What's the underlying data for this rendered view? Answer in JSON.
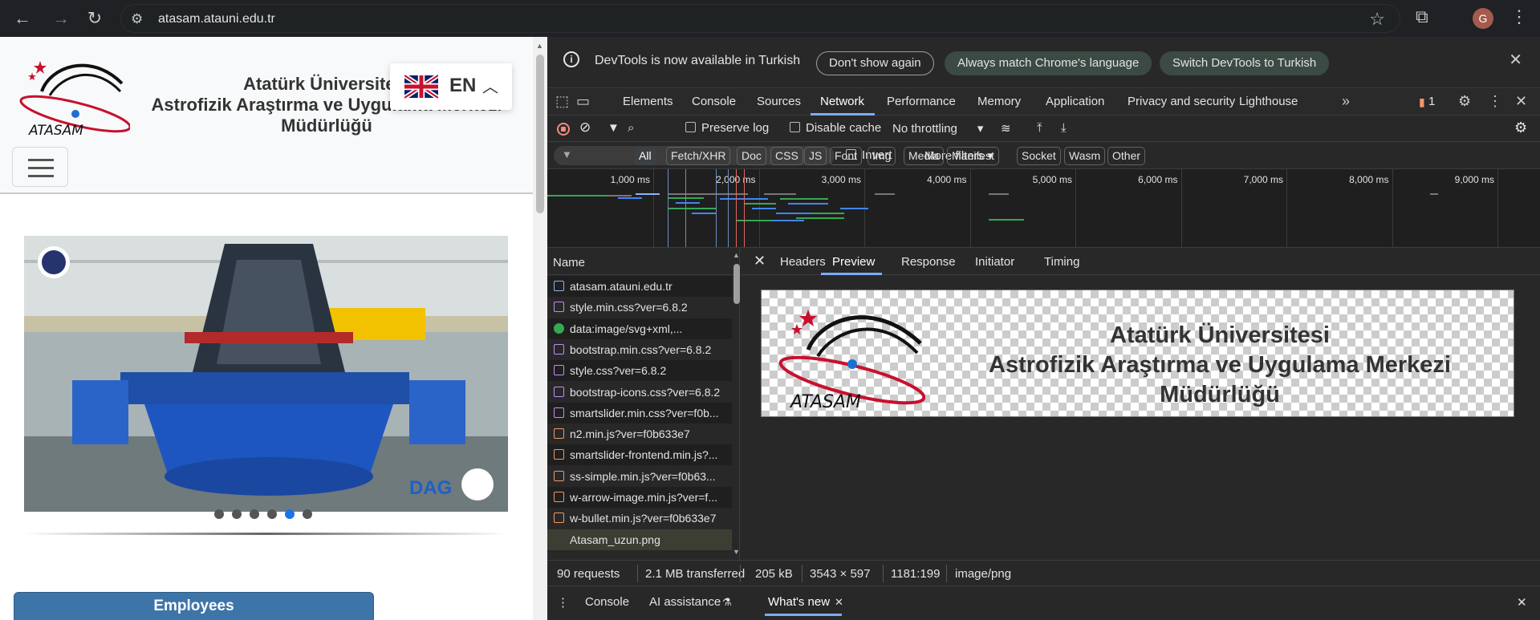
{
  "browser": {
    "url": "atasam.atauni.edu.tr",
    "avatar_letter": "G"
  },
  "site": {
    "logo_text": "ATASAM",
    "title_lines": [
      "Atatürk Üniversitesi",
      "Astrofizik Araştırma ve Uygulama Merkezi",
      "Müdürlüğü"
    ],
    "language": "EN",
    "slider_dots": 6,
    "slider_active_dot": 5,
    "slide_badge": "DAG",
    "employees_label": "Employees"
  },
  "devtools": {
    "infobar": {
      "message": "DevTools is now available in Turkish",
      "dont_show": "Don't show again",
      "always_match": "Always match Chrome's language",
      "switch": "Switch DevTools to Turkish"
    },
    "tabs": [
      "Elements",
      "Console",
      "Sources",
      "Network",
      "Performance",
      "Memory",
      "Application",
      "Privacy and security",
      "Lighthouse"
    ],
    "selected_tab": "Network",
    "issues_count": "1",
    "toolbar": {
      "preserve_log": "Preserve log",
      "disable_cache": "Disable cache",
      "throttling": "No throttling"
    },
    "filter": {
      "invert": "Invert",
      "more_filters": "More filters",
      "types": [
        "All",
        "Fetch/XHR",
        "Doc",
        "CSS",
        "JS",
        "Font",
        "Img",
        "Media",
        "Manifest",
        "Socket",
        "Wasm",
        "Other"
      ],
      "selected_type": "All"
    },
    "timeline_ticks": [
      "1,000 ms",
      "2,000 ms",
      "3,000 ms",
      "4,000 ms",
      "5,000 ms",
      "6,000 ms",
      "7,000 ms",
      "8,000 ms",
      "9,000 ms"
    ],
    "name_header": "Name",
    "requests": [
      {
        "name": "atasam.atauni.edu.tr",
        "type": "doc"
      },
      {
        "name": "style.min.css?ver=6.8.2",
        "type": "css"
      },
      {
        "name": "data:image/svg+xml,...",
        "type": "svg"
      },
      {
        "name": "bootstrap.min.css?ver=6.8.2",
        "type": "css"
      },
      {
        "name": "style.css?ver=6.8.2",
        "type": "css"
      },
      {
        "name": "bootstrap-icons.css?ver=6.8.2",
        "type": "css"
      },
      {
        "name": "smartslider.min.css?ver=f0b...",
        "type": "css"
      },
      {
        "name": "n2.min.js?ver=f0b633e7",
        "type": "js"
      },
      {
        "name": "smartslider-frontend.min.js?...",
        "type": "js"
      },
      {
        "name": "ss-simple.min.js?ver=f0b63...",
        "type": "js"
      },
      {
        "name": "w-arrow-image.min.js?ver=f...",
        "type": "js"
      },
      {
        "name": "w-bullet.min.js?ver=f0b633e7",
        "type": "js"
      },
      {
        "name": "Atasam_uzun.png",
        "type": "img"
      }
    ],
    "detail_tabs": [
      "Headers",
      "Preview",
      "Response",
      "Initiator",
      "Timing"
    ],
    "selected_detail_tab": "Preview",
    "preview": {
      "logo_text": "ATASAM",
      "title_lines": [
        "Atatürk Üniversitesi",
        "Astrofizik Araştırma ve Uygulama Merkezi",
        "Müdürlüğü"
      ]
    },
    "status": {
      "requests": "90 requests",
      "transferred": "2.1 MB transferred",
      "size": "205 kB",
      "dimensions": "3543 × 597",
      "ratio": "1181:199",
      "mime": "image/png"
    },
    "drawer_tabs": [
      "Console",
      "AI assistance",
      "What's new"
    ],
    "selected_drawer_tab": "What's new",
    "colors": {
      "accent": "#7cacf8",
      "panel": "#282828",
      "css": "#c58af9",
      "js": "#f29766",
      "doc": "#8ab4f8"
    }
  }
}
